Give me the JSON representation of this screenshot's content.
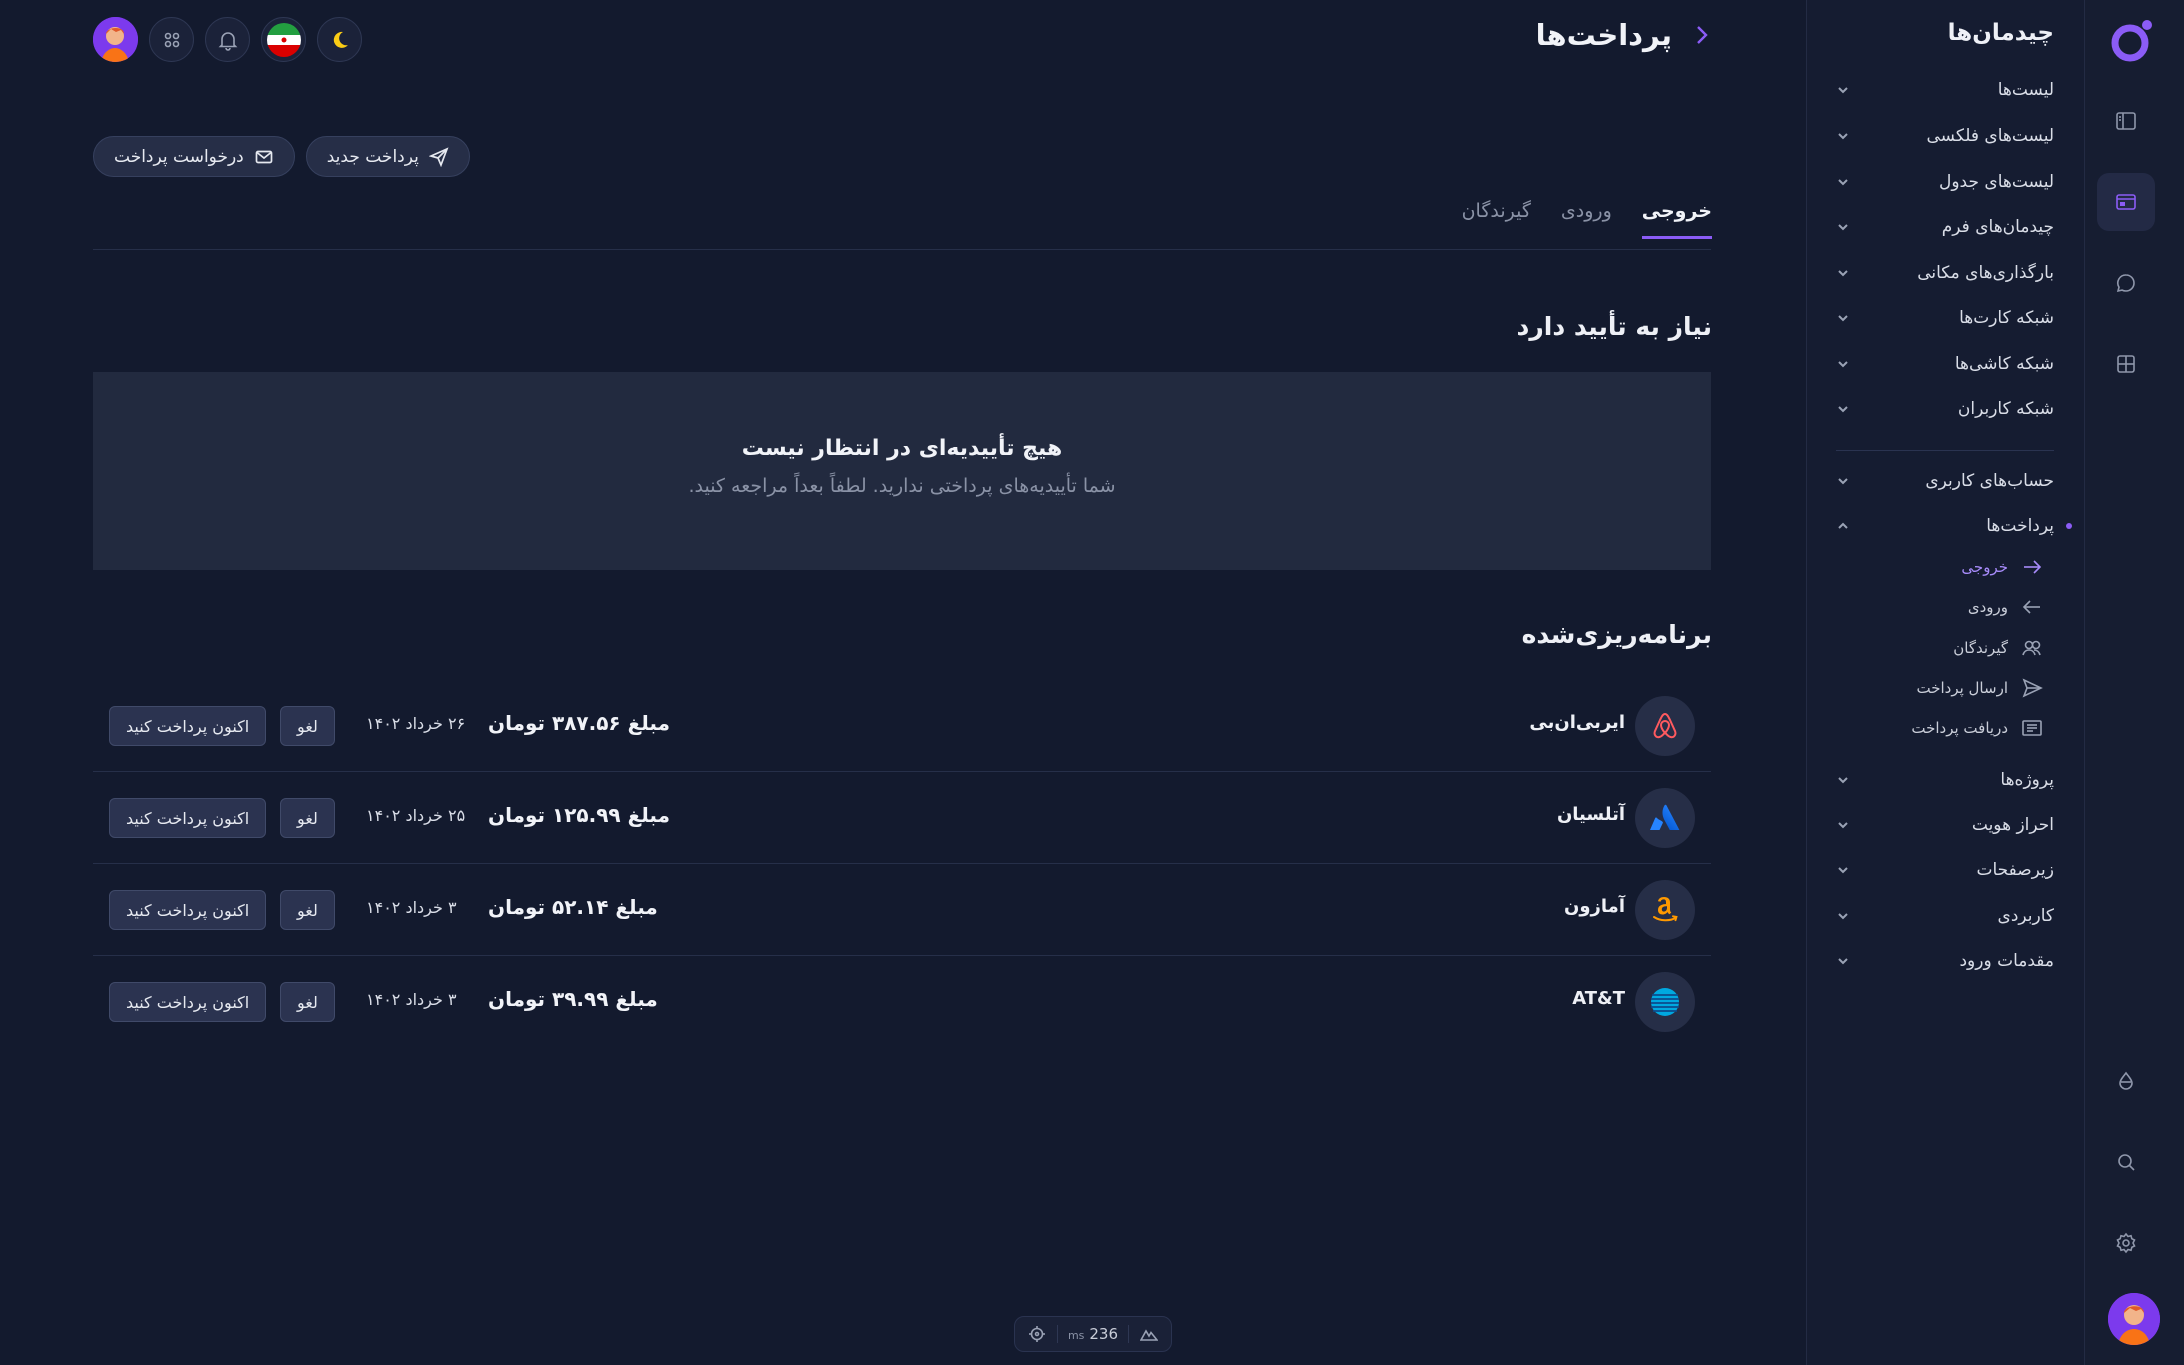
{
  "app": {
    "sidebar_title": "چیدمان‌ها",
    "page_title": "پرداخت‌ها"
  },
  "colors": {
    "accent": "#8b5cf6",
    "background": "#131a2e",
    "panel": "#222a3f"
  },
  "rail": {
    "icons": [
      "logo-icon",
      "sidebar-layout-icon",
      "browser-window-icon",
      "chat-icon",
      "grid-icon",
      "drop-icon",
      "search-icon",
      "gear-icon",
      "avatar"
    ],
    "active": "browser-window-icon"
  },
  "sidebar": {
    "items": [
      {
        "label": "لیست‌ها"
      },
      {
        "label": "لیست‌های فلکسی"
      },
      {
        "label": "لیست‌های جدول"
      },
      {
        "label": "چیدمان‌های فرم"
      },
      {
        "label": "بارگذاری‌های مکانی"
      },
      {
        "label": "شبکه کارت‌ها"
      },
      {
        "label": "شبکه کاشی‌ها"
      },
      {
        "label": "شبکه کاربران"
      },
      {
        "label": "حساب‌های کاربری"
      },
      {
        "label": "پرداخت‌ها"
      },
      {
        "label": "پروژه‌ها"
      },
      {
        "label": "احراز هویت"
      },
      {
        "label": "زیرصفحات"
      },
      {
        "label": "کاربردی"
      },
      {
        "label": "مقدمات ورود"
      }
    ],
    "subitems": [
      {
        "label": "خروجی",
        "icon": "arrow-right-icon"
      },
      {
        "label": "ورودی",
        "icon": "arrow-left-icon"
      },
      {
        "label": "گیرندگان",
        "icon": "users-icon"
      },
      {
        "label": "ارسال پرداخت",
        "icon": "send-icon"
      },
      {
        "label": "دریافت پرداخت",
        "icon": "receipt-icon"
      }
    ]
  },
  "header": {
    "buttons": {
      "new_payment": "پرداخت جدید",
      "request_payment": "درخواست پرداخت"
    }
  },
  "tabs": [
    {
      "label": "خروجی"
    },
    {
      "label": "ورودی"
    },
    {
      "label": "گیرندگان"
    }
  ],
  "approval": {
    "title": "نیاز به تأیید دارد",
    "empty_title": "هیچ تأییدیه‌ای در انتظار نیست",
    "empty_subtitle": "شما تأییدیه‌های پرداختی ندارید. لطفاً بعداً مراجعه کنید."
  },
  "scheduled": {
    "title": "برنامه‌ریزی‌شده",
    "cancel_label": "لغو",
    "pay_now_label": "اکنون پرداخت کنید",
    "rows": [
      {
        "name": "ایربی‌ان‌بی",
        "amount": "مبلغ ۳۸۷.۵۶ تومان",
        "date": "۲۶ خرداد ۱۴۰۲",
        "logo": "airbnb-logo-icon"
      },
      {
        "name": "آتلسیان",
        "amount": "مبلغ ۱۲۵.۹۹ تومان",
        "date": "۲۵ خرداد ۱۴۰۲",
        "logo": "atlassian-logo-icon"
      },
      {
        "name": "آمازون",
        "amount": "مبلغ ۵۲.۱۴ تومان",
        "date": "۳ خرداد ۱۴۰۲",
        "logo": "amazon-logo-icon"
      },
      {
        "name": "AT&T",
        "amount": "مبلغ ۳۹.۹۹ تومان",
        "date": "۳ خرداد ۱۴۰۲",
        "logo": "att-logo-icon"
      }
    ]
  },
  "devbar": {
    "ms_value": "236",
    "ms_unit": "ms"
  }
}
